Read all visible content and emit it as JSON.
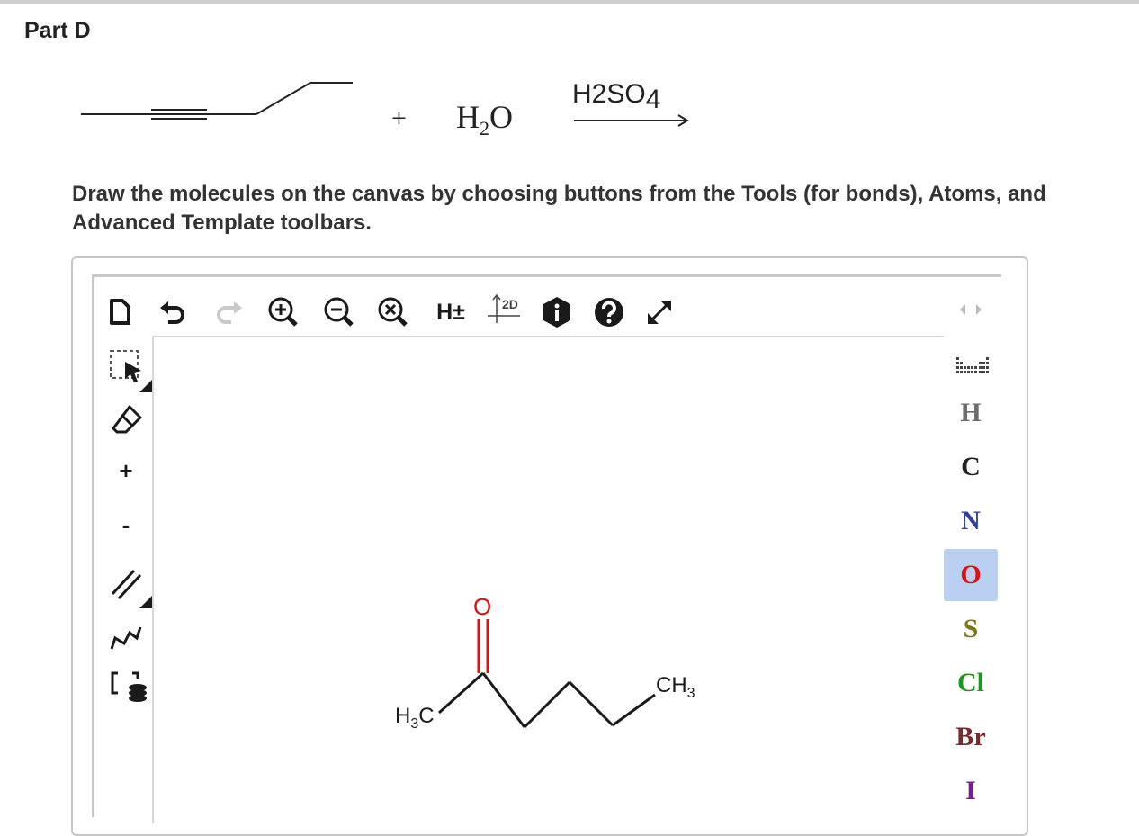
{
  "page": {
    "part_title": "Part D",
    "instructions": "Draw the molecules on the canvas by choosing buttons from the Tools (for bonds), Atoms, and Advanced Template toolbars."
  },
  "reaction": {
    "plus": "+",
    "water": {
      "main": "H",
      "sub": "2",
      "tail": "O"
    },
    "catalyst": {
      "main": "H",
      "sub1": "2",
      "mid": "SO",
      "sub2": "4"
    }
  },
  "toolbar": {
    "h_toggle": "H±",
    "label_2d": "2D"
  },
  "left_toolbar": {
    "charge_plus": "+",
    "charge_minus": "-"
  },
  "atoms": [
    {
      "symbol": "H",
      "color": "#6e6e6e"
    },
    {
      "symbol": "C",
      "color": "#222222"
    },
    {
      "symbol": "N",
      "color": "#2f3fa4"
    },
    {
      "symbol": "O",
      "color": "#e01010",
      "selected": true
    },
    {
      "symbol": "S",
      "color": "#7a7a10"
    },
    {
      "symbol": "Cl",
      "color": "#1a9a1a"
    },
    {
      "symbol": "Br",
      "color": "#7a2a2a"
    },
    {
      "symbol": "I",
      "color": "#7a1a9a"
    }
  ],
  "molecule": {
    "oxygen": "O",
    "left_group": {
      "main": "H",
      "sub": "3",
      "tail": "C"
    },
    "right_group": {
      "main": "CH",
      "sub": "3"
    }
  },
  "colors": {
    "selected_atom_bg": "#b9d0f0",
    "frame_border": "#c6c6c6",
    "oxygen_red": "#e01010"
  }
}
